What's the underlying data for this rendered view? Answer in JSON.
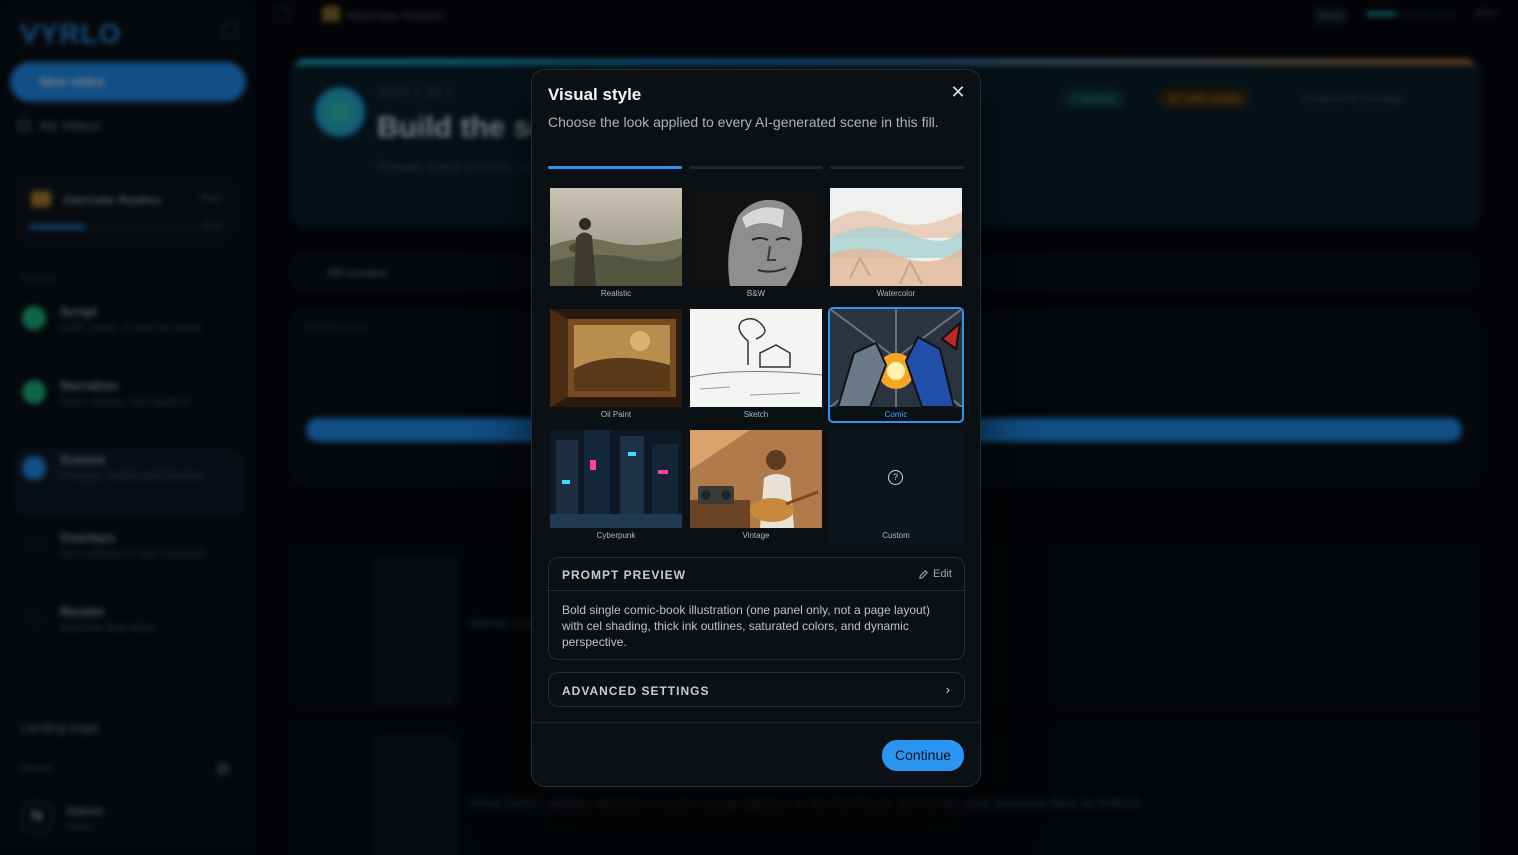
{
  "sidebar": {
    "logo": "VYRLO",
    "new_video": "New video",
    "my_videos": "My Videos",
    "project": {
      "name": "Alternate Realms",
      "badge": "Beat",
      "progress_pct": "40%"
    },
    "steps_label": "STEPS",
    "steps": [
      {
        "title": "Script",
        "sub": "Draft, paste, or edit the script"
      },
      {
        "title": "Narration",
        "sub": "Voice, timing, and captions"
      },
      {
        "title": "Scenes",
        "sub": "Prompts, media, and timeline"
      },
      {
        "title": "Overlays",
        "sub": "Text callouts for key moments"
      },
      {
        "title": "Render",
        "sub": "Build the final video"
      }
    ],
    "landing": "Landing page",
    "footer_label": "Theme",
    "user": {
      "initial": "N",
      "name": "Admin",
      "plan": "Admin"
    }
  },
  "topbar": {
    "crumb": "Alternate Realms",
    "saved": "Beat",
    "progress": "40%"
  },
  "hero": {
    "step": "STEP 3 OF 5",
    "title": "Build the scenes",
    "desc": "Prepare scene prompts, generate media, and review every scene before export",
    "pill1": "7 scenes",
    "pill2": "0/7 with media",
    "pill3": "Continue to Overlays"
  },
  "background": {
    "all_scenes": "All scenes",
    "batch_fill": "BATCH FILL",
    "row1_text": "Batman and Superman clash over Metropolis",
    "row2_text": "When Earth's satellites detected a massive energy signature on the Red Planet, both heroes were teleported there by SHIELD"
  },
  "modal": {
    "title": "Visual style",
    "description": "Choose the look applied to every AI-generated scene in this fill.",
    "styles": [
      {
        "label": "Realistic",
        "icon": "realistic-style-image"
      },
      {
        "label": "B&W",
        "icon": "bw-style-image"
      },
      {
        "label": "Watercolor",
        "icon": "watercolor-style-image"
      },
      {
        "label": "Oil Paint",
        "icon": "oil-paint-style-image"
      },
      {
        "label": "Sketch",
        "icon": "sketch-style-image"
      },
      {
        "label": "Comic",
        "icon": "comic-style-image"
      },
      {
        "label": "Cyberpunk",
        "icon": "cyberpunk-style-image"
      },
      {
        "label": "Vintage",
        "icon": "vintage-style-image"
      },
      {
        "label": "Custom",
        "icon": "question-icon"
      }
    ],
    "selected_style": "Comic",
    "prompt_preview": {
      "title": "PROMPT PREVIEW",
      "edit": "Edit",
      "text": "Bold single comic-book illustration (one panel only, not a page layout) with cel shading, thick ink outlines, saturated colors, and dynamic perspective."
    },
    "advanced": "ADVANCED SETTINGS",
    "continue": "Continue",
    "accent": "#2a96f2"
  }
}
